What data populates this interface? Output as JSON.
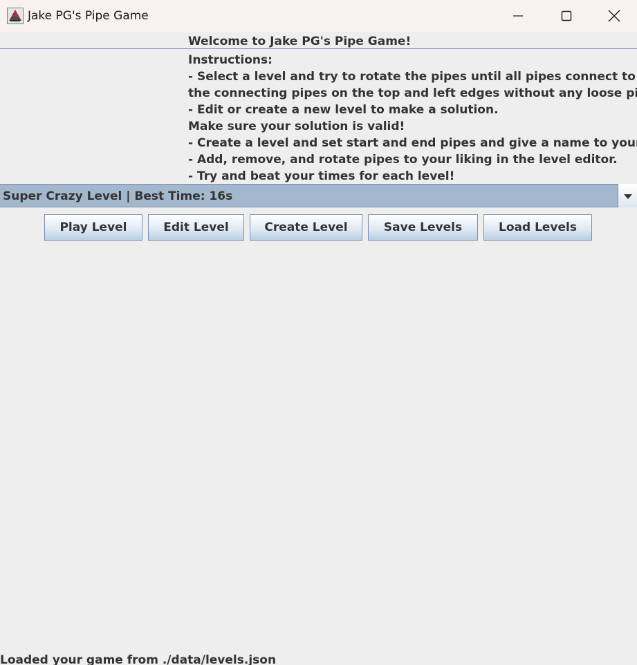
{
  "window": {
    "title": "Jake PG's Pipe Game",
    "icon": "java-cup-icon",
    "controls": [
      "minimize-icon",
      "maximize-icon",
      "close-icon"
    ]
  },
  "header": {
    "welcome": "Welcome to Jake PG's Pipe Game!"
  },
  "instructions": {
    "lines": [
      "Instructions:",
      "- Select a level and try to rotate the pipes until all pipes connect to",
      "the connecting pipes on the top and left edges without any loose pipes.",
      "- Edit or create a new level to make a solution.",
      "Make sure your solution is valid!",
      "- Create a level and set start and end pipes and give a name to your level",
      "- Add, remove, and rotate pipes to your liking in the level editor.",
      "- Try and beat your times for each level!"
    ]
  },
  "level_select": {
    "selected": "Super Crazy Level | Best Time: 16s",
    "arrow_icon": "chevron-down-icon"
  },
  "actions": {
    "play": "Play Level",
    "edit": "Edit Level",
    "create": "Create Level",
    "save": "Save Levels",
    "load": "Load Levels"
  },
  "status": {
    "message": "Loaded your game from ./data/levels.json"
  },
  "colors": {
    "background": "#eeeeee",
    "titlebar": "#f7f2ef",
    "combo_selection": "#a3b8cc",
    "border": "#7a8cb3",
    "text": "#333333"
  }
}
